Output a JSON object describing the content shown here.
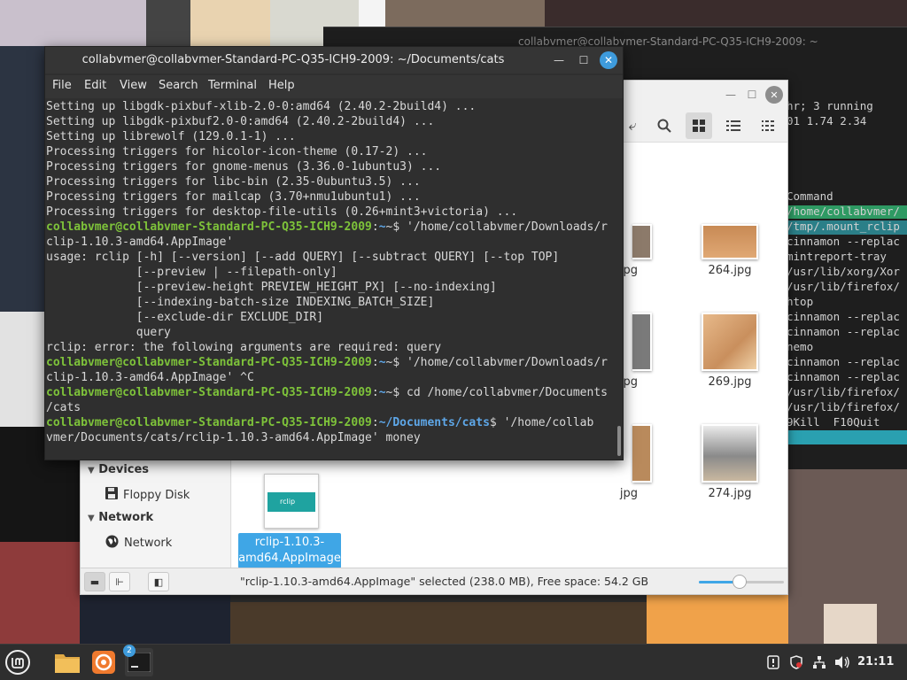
{
  "terminal": {
    "title": "collabvmer@collabvmer-Standard-PC-Q35-ICH9-2009: ~/Documents/cats",
    "menu": [
      "File",
      "Edit",
      "View",
      "Search",
      "Terminal",
      "Help"
    ],
    "lines": [
      "Setting up libgdk-pixbuf-xlib-2.0-0:amd64 (2.40.2-2build4) ...",
      "Setting up libgdk-pixbuf2.0-0:amd64 (2.40.2-2build4) ...",
      "Setting up librewolf (129.0.1-1) ...",
      "Processing triggers for hicolor-icon-theme (0.17-2) ...",
      "Processing triggers for gnome-menus (3.36.0-1ubuntu3) ...",
      "Processing triggers for libc-bin (2.35-0ubuntu3.5) ...",
      "Processing triggers for mailcap (3.70+nmu1ubuntu1) ...",
      "Processing triggers for desktop-file-utils (0.26+mint3+victoria) ..."
    ],
    "prompt_user": "collabvmer@collabvmer-Standard-PC-Q35-ICH9-2009",
    "cmd1": "~$ '/home/collabvmer/Downloads/r",
    "cmd1b": "clip-1.10.3-amd64.AppImage'",
    "usage_lines": [
      "usage: rclip [-h] [--version] [--add QUERY] [--subtract QUERY] [--top TOP]",
      "             [--preview | --filepath-only]",
      "             [--preview-height PREVIEW_HEIGHT_PX] [--no-indexing]",
      "             [--indexing-batch-size INDEXING_BATCH_SIZE]",
      "             [--exclude-dir EXCLUDE_DIR]",
      "             query",
      "rclip: error: the following arguments are required: query"
    ],
    "cmd2": "~$ '/home/collabvmer/Downloads/r",
    "cmd2b": "clip-1.10.3-amd64.AppImage' ^C",
    "cmd3": "~$ cd /home/collabvmer/Documents",
    "cmd3b": "/cats",
    "prompt_path": "~/Documents/cats",
    "cmd4": "$ '/home/collab",
    "cmd4b": "vmer/Documents/cats/rclip-1.10.3-amd64.AppImage' money"
  },
  "background_terminal": {
    "title": "collabvmer@collabvmer-Standard-PC-Q35-ICH9-2009: ~",
    "lines": [
      "hr; 3 running",
      "01 1.74 2.34",
      "",
      "",
      "",
      "",
      "Command",
      "/home/collabvmer/",
      "/tmp/.mount_rclip",
      "cinnamon --replac",
      "mintreport-tray",
      "/usr/lib/xorg/Xor",
      "/usr/lib/firefox/",
      "htop",
      "cinnamon --replac",
      "cinnamon --replac",
      "nemo",
      "cinnamon --replac",
      "cinnamon --replac",
      "/usr/lib/firefox/",
      "/usr/lib/firefox/",
      "9Kill  F10Quit"
    ]
  },
  "file_manager": {
    "sidebar": {
      "devices_label": "Devices",
      "floppy_label": "Floppy Disk",
      "network_label": "Network",
      "network_item": "Network"
    },
    "files": [
      {
        "name": "264.jpg"
      },
      {
        "name": "269.jpg"
      },
      {
        "name": "274.jpg"
      },
      {
        "name": "rclip-1.10.3-amd64.AppImage"
      }
    ],
    "partial_labels": [
      "jpg",
      "jpg",
      "jpg"
    ],
    "selected_label_line1": "rclip-1.10.3-",
    "selected_label_line2": "amd64.AppImage",
    "appimage_icon_text": "rclip",
    "status_text": "\"rclip-1.10.3-amd64.AppImage\" selected (238.0 MB), Free space: 54.2 GB",
    "zoom_level": 0.48
  },
  "taskbar": {
    "badge_count": "2",
    "clock": "21:11"
  },
  "colors": {
    "accent": "#3fa6e6",
    "prompt_user": "#7ec33a",
    "prompt_path": "#5ea7e8",
    "selection": "#3fa6e6"
  }
}
